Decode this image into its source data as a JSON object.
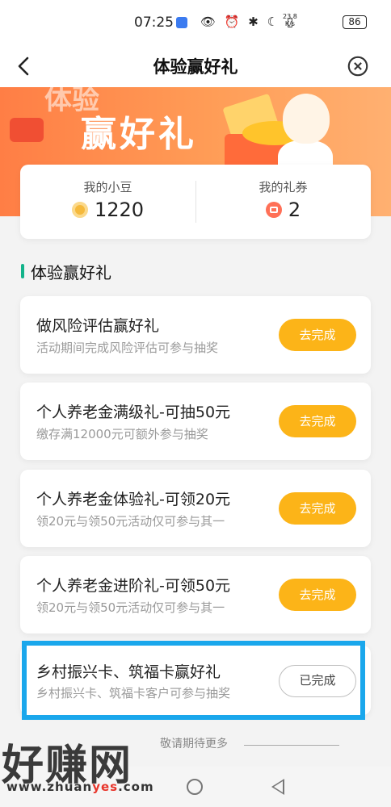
{
  "status_bar": {
    "time": "07:25",
    "icons": "👁 ⏰ ✱ ☾ ▯",
    "speed_value": "23.8",
    "speed_unit": "K/s",
    "battery": "86"
  },
  "header": {
    "title": "体验赢好礼",
    "back_icon": "chevron-left-icon",
    "close_icon": "close-circle-icon"
  },
  "banner": {
    "ghost_text": "体验",
    "headline": "赢好礼"
  },
  "summary": {
    "beans_label": "我的小豆",
    "beans_value": "1220",
    "coupons_label": "我的礼券",
    "coupons_value": "2"
  },
  "section": {
    "title": "体验赢好礼"
  },
  "tasks": [
    {
      "name": "做风险评估赢好礼",
      "desc": "活动期间完成风险评估可参与抽奖",
      "button": "去完成",
      "done": false
    },
    {
      "name": "个人养老金满级礼-可抽50元",
      "desc": "缴存满12000元可额外参与抽奖",
      "button": "去完成",
      "done": false
    },
    {
      "name": "个人养老金体验礼-可领20元",
      "desc": "领20元与领50元活动仅可参与其一",
      "button": "去完成",
      "done": false
    },
    {
      "name": "个人养老金进阶礼-可领50元",
      "desc": "领20元与领50元活动仅可参与其一",
      "button": "去完成",
      "done": false
    },
    {
      "name": "乡村振兴卡、筑福卡赢好礼",
      "desc": "乡村振兴卡、筑福卡客户可参与抽奖",
      "button": "已完成",
      "done": true
    }
  ],
  "footer": {
    "more_text": "敬请期待更多"
  },
  "watermark": {
    "text": "好赚网",
    "url_prefix": "www.zhuan",
    "url_mid": "yes",
    "url_suffix": ".com"
  },
  "colors": {
    "accent_button": "#fcb418",
    "section_bar": "#13b38a",
    "highlight_border": "#1aa7ec",
    "banner_orange": "#ff7e45"
  }
}
